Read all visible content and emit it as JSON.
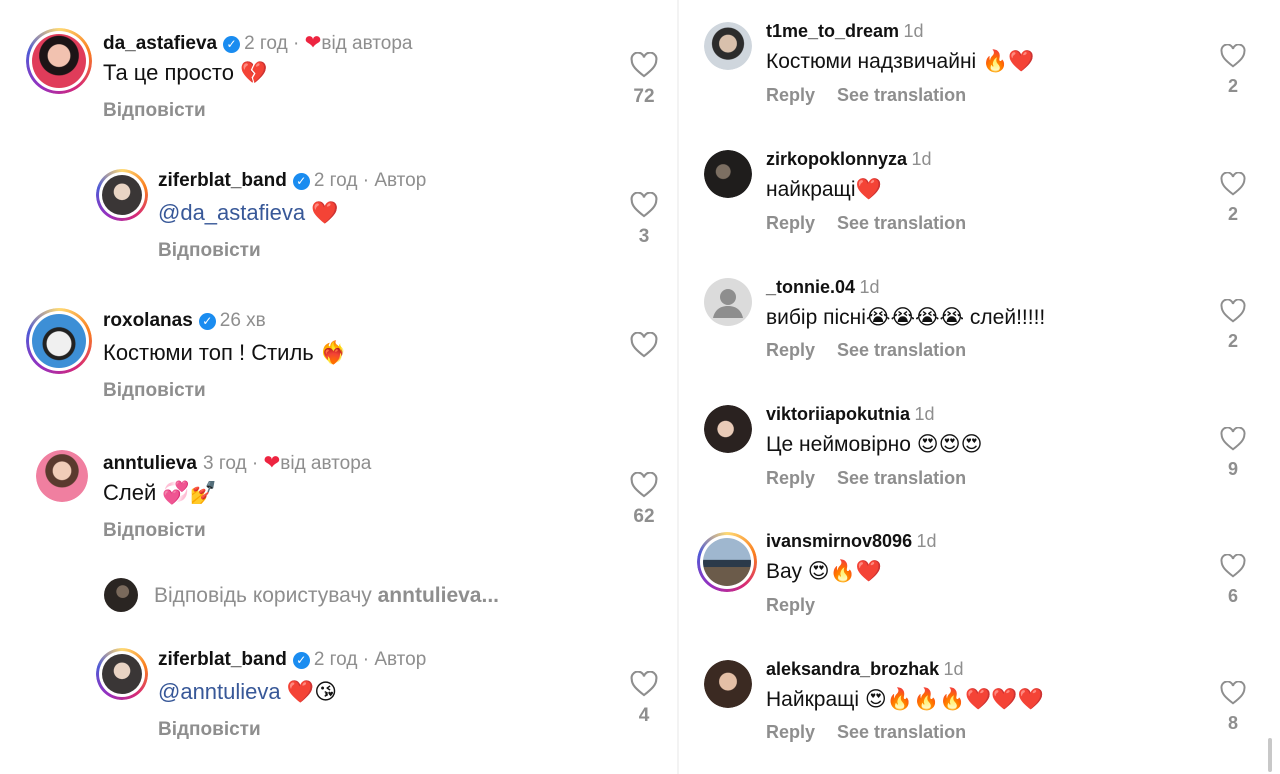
{
  "left_comments": [
    {
      "username": "da_astafieva",
      "verified": true,
      "time": "2 год",
      "by_author_label": "від автора",
      "text": "Та це просто",
      "emoji": "💔",
      "reply_label": "Відповісти",
      "likes": "72"
    },
    {
      "username": "ziferblat_band",
      "verified": true,
      "time": "2 год",
      "author_tag": "Автор",
      "mention": "@da_astafieva",
      "emoji": "❤️",
      "reply_label": "Відповісти",
      "likes": "3"
    },
    {
      "username": "roxolanas",
      "verified": true,
      "time": "26 хв",
      "text": "Костюми топ ! Стиль",
      "emoji": "❤️‍🔥",
      "reply_label": "Відповісти",
      "likes": ""
    },
    {
      "username": "anntulieva",
      "verified": false,
      "time": "3 год",
      "by_author_label": "від автора",
      "text": "Слей",
      "emoji": "💞💅",
      "reply_label": "Відповісти",
      "likes": "62"
    },
    {
      "username": "ziferblat_band",
      "verified": true,
      "time": "2 год",
      "author_tag": "Автор",
      "mention": "@anntulieva",
      "emoji": "❤️😘",
      "reply_label": "Відповісти",
      "likes": "4"
    }
  ],
  "reply_thread": {
    "prefix": "Відповідь користувачу",
    "user": "anntulieva..."
  },
  "right_comments": [
    {
      "username": "t1me_to_dream",
      "time": "1d",
      "text": "Костюми надзвичайні",
      "emoji": "🔥❤️",
      "reply_label": "Reply",
      "translate_label": "See translation",
      "likes": "2"
    },
    {
      "username": "zirkopoklonnyza",
      "time": "1d",
      "text": "найкращі",
      "emoji": "❤️",
      "reply_label": "Reply",
      "translate_label": "See translation",
      "likes": "2"
    },
    {
      "username": "_tonnie.04",
      "time": "1d",
      "text": "вибір пісні",
      "emoji": "😭😭😭😭",
      "text2": "слей!!!!!",
      "reply_label": "Reply",
      "translate_label": "See translation",
      "likes": "2"
    },
    {
      "username": "viktoriiapokutnia",
      "time": "1d",
      "text": "Це неймовірно",
      "emoji": "😍😍😍",
      "reply_label": "Reply",
      "translate_label": "See translation",
      "likes": "9"
    },
    {
      "username": "ivansmirnov8096",
      "time": "1d",
      "text": "Вау",
      "emoji": "😍🔥❤️",
      "reply_label": "Reply",
      "translate_label": "",
      "likes": "6"
    },
    {
      "username": "aleksandra_brozhak",
      "time": "1d",
      "text": "Найкращі",
      "emoji": "😍🔥🔥🔥❤️❤️❤️",
      "reply_label": "Reply",
      "translate_label": "See translation",
      "likes": "8"
    }
  ],
  "colors": {
    "verified": "#1a8cf0",
    "heart_red": "#ed2440",
    "muted_text": "#8e8e8e",
    "mention": "#385898"
  },
  "icons": {
    "like": "heart-outline-icon",
    "verified": "verified-badge-icon",
    "author_liked": "heart-filled-icon"
  }
}
